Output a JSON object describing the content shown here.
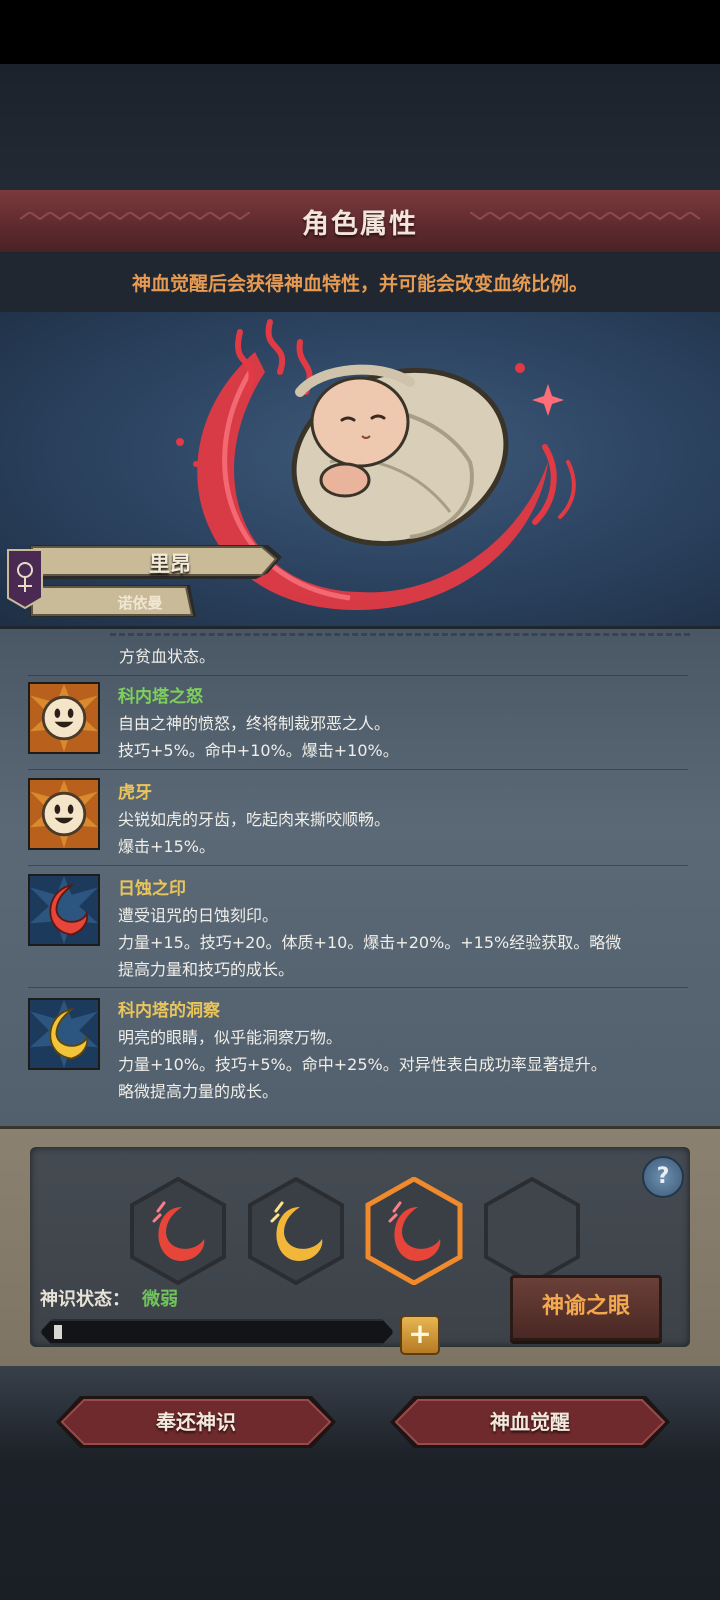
{
  "header": {
    "title": "角色属性"
  },
  "notice": "神血觉醒后会获得神血特性，并可能会改变血统比例。",
  "hero": {
    "name": "里昂",
    "clan": "诺依曼"
  },
  "traits_cut_text": "方贫血状态。",
  "traits": [
    {
      "name": "科内塔之怒",
      "name_color": "#7ed05c",
      "icon": "smiley-face-icon",
      "lines": [
        "自由之神的愤怒，终将制裁邪恶之人。",
        "技巧+5%。命中+10%。爆击+10%。"
      ]
    },
    {
      "name": "虎牙",
      "name_color": "#e9c55a",
      "icon": "smiley-face-icon",
      "lines": [
        "尖锐如虎的牙齿，吃起肉来撕咬顺畅。",
        "爆击+15%。"
      ]
    },
    {
      "name": "日蚀之印",
      "name_color": "#e9c55a",
      "icon": "red-crescent-icon",
      "lines": [
        "遭受诅咒的日蚀刻印。",
        "力量+15。技巧+20。体质+10。爆击+20%。+15%经验获取。略微",
        "提高力量和技巧的成长。"
      ]
    },
    {
      "name": "科内塔的洞察",
      "name_color": "#e9c55a",
      "icon": "gold-crescent-icon",
      "lines": [
        "明亮的眼睛，似乎能洞察万物。",
        "力量+10%。技巧+5%。命中+25%。对异性表白成功率显著提升。",
        "略微提高力量的成长。"
      ]
    }
  ],
  "divine": {
    "slots": [
      "red-crescent-icon",
      "gold-crescent-icon",
      "red-crescent-icon",
      "empty"
    ],
    "help": "?",
    "status_label": "神识状态：",
    "status_value": "微弱",
    "progress": 0.02,
    "plus": "+",
    "oracle_button": "神谕之眼"
  },
  "footer": {
    "return_button": "奉还神识",
    "awaken_button": "神血觉醒"
  },
  "colors": {
    "accent_red": "#e23a44",
    "accent_gold": "#f5a94e",
    "green_status": "#6fc35a"
  }
}
